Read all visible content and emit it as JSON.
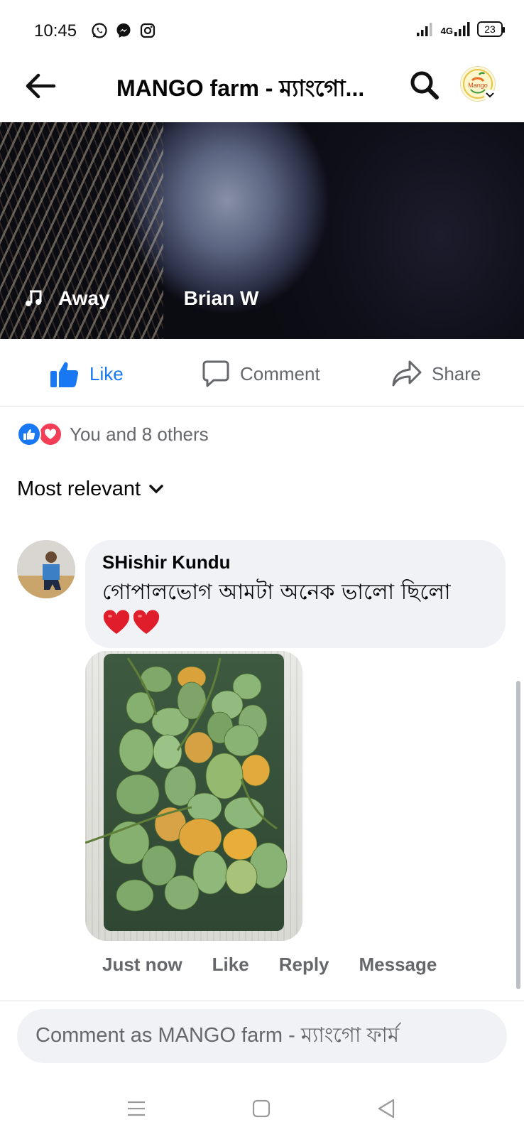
{
  "status_bar": {
    "time": "10:45",
    "network": "4G",
    "battery": "23"
  },
  "header": {
    "title": "MANGO farm - ম্যাংগো...",
    "avatar_text": "Mango"
  },
  "video": {
    "song": "Away",
    "artist": "Brian W"
  },
  "actions": {
    "like_label": "Like",
    "comment_label": "Comment",
    "share_label": "Share"
  },
  "reactions": {
    "summary": "You and 8 others"
  },
  "sort": {
    "label": "Most relevant"
  },
  "comment": {
    "author": "SHishir Kundu",
    "text": "গোপালভোগ আমটা অনেক ভালো ছিলো",
    "emoji": "❤️❤️",
    "time": "Just now",
    "like_label": "Like",
    "reply_label": "Reply",
    "message_label": "Message"
  },
  "composer": {
    "placeholder": "Comment as MANGO farm - ম্যাংগো ফার্ম"
  },
  "colors": {
    "accent": "#1877f2",
    "love": "#f33e58",
    "muted_text": "#65676b",
    "bubble_bg": "#f0f2f5"
  },
  "icons": {
    "whatsapp": "whatsapp-icon",
    "messenger": "messenger-icon",
    "instagram": "instagram-icon",
    "back": "back-arrow-icon",
    "search": "search-icon",
    "music": "music-note-icon",
    "like": "thumbs-up-icon",
    "comment": "comment-bubble-icon",
    "share": "share-arrow-icon",
    "chevron": "chevron-down-icon"
  }
}
